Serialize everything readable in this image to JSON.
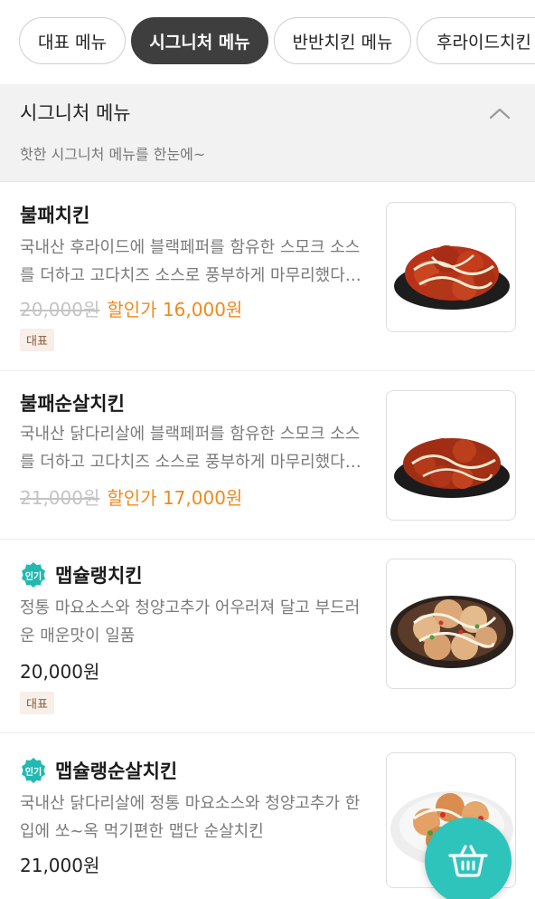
{
  "tabs": [
    {
      "label": "대표 메뉴",
      "active": false
    },
    {
      "label": "시그니처 메뉴",
      "active": true
    },
    {
      "label": "반반치킨 메뉴",
      "active": false
    },
    {
      "label": "후라이드치킨",
      "active": false
    }
  ],
  "section": {
    "title": "시그니처 메뉴",
    "subtitle": "핫한 시그니처 메뉴를 한눈에~"
  },
  "items": [
    {
      "name": "불패치킨",
      "description": "국내산 후라이드에 블랙페퍼를 함유한 스모크 소스를 더하고 고다치즈 소스로 풍부하게 마무리했다…",
      "original_price": "20,000원",
      "sale_price": "할인가 16,000원",
      "tag": "대표"
    },
    {
      "name": "불패순살치킨",
      "description": "국내산 닭다리살에 블랙페퍼를 함유한 스모크 소스를 더하고 고다치즈 소스로 풍부하게 마무리했다…",
      "original_price": "21,000원",
      "sale_price": "할인가 17,000원"
    },
    {
      "badge": "인기",
      "name": "맵슐랭치킨",
      "description": "정통 마요소스와 청양고추가 어우러져 달고 부드러운 매운맛이 일품",
      "price": "20,000원",
      "tag": "대표"
    },
    {
      "badge": "인기",
      "name": "맵슐랭순살치킨",
      "description": "국내산 닭다리살에 정통 마요소스와 청양고추가 한입에 쏘~옥 먹기편한 맵단 순살치킨",
      "price": "21,000원"
    }
  ],
  "colors": {
    "accent_orange": "#f08a1c",
    "cart_teal": "#2ec4bc",
    "active_tab": "#3e3e3e",
    "popular_badge": "#21b9b1"
  },
  "icons": {
    "collapse": "chevron-up-icon",
    "cart": "basket-icon"
  }
}
